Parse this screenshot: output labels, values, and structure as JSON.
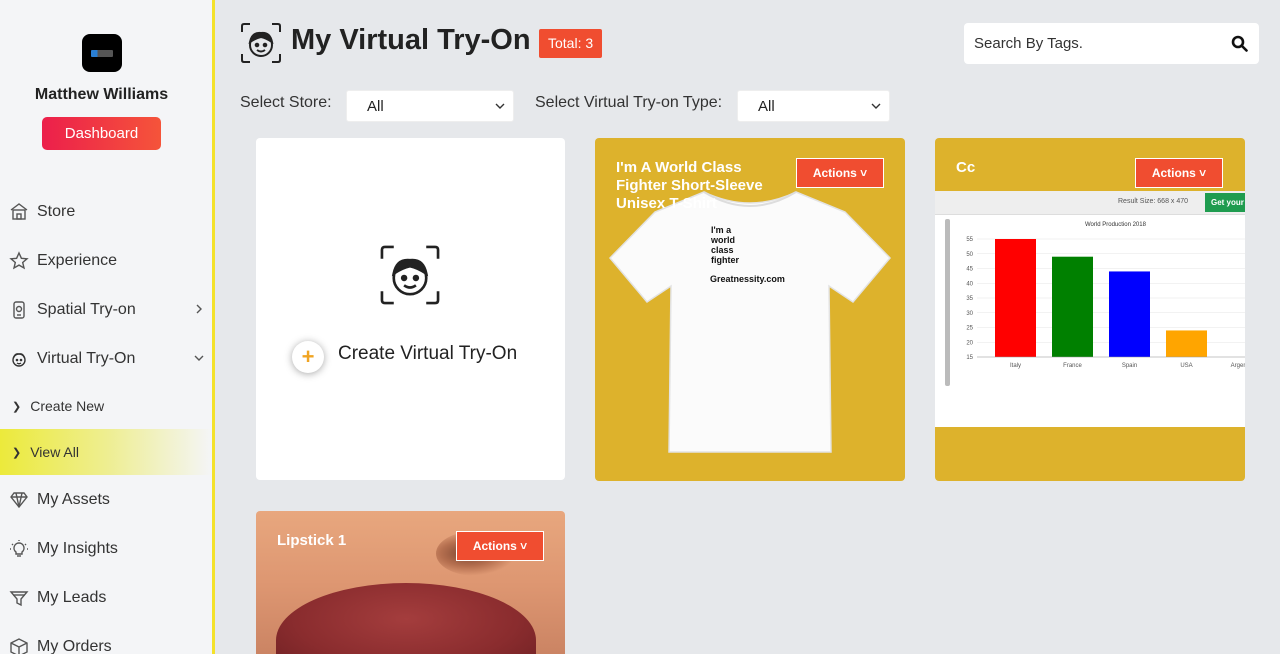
{
  "sidebar": {
    "user_name": "Matthew Williams",
    "dashboard_label": "Dashboard",
    "items": [
      {
        "label": "Store",
        "icon": "store-icon"
      },
      {
        "label": "Experience",
        "icon": "star-icon"
      },
      {
        "label": "Spatial Try-on",
        "icon": "phone-ar-icon"
      },
      {
        "label": "Virtual Try-On",
        "icon": "face-icon"
      },
      {
        "label": "My Assets",
        "icon": "diamond-icon"
      },
      {
        "label": "My Insights",
        "icon": "bulb-icon"
      },
      {
        "label": "My Leads",
        "icon": "funnel-icon"
      },
      {
        "label": "My Orders",
        "icon": "box-icon"
      }
    ],
    "sub_items": [
      {
        "label": "Create New"
      },
      {
        "label": "View All"
      }
    ]
  },
  "header": {
    "title": "My Virtual Try-On",
    "total_badge": "Total: 3",
    "search_placeholder": "Search By Tags."
  },
  "filters": {
    "store_label": "Select Store:",
    "store_value": "All",
    "type_label": "Select Virtual Try-on Type:",
    "type_value": "All"
  },
  "cards": {
    "create_label": "Create Virtual Try-On",
    "actions_label": "Actions",
    "items": [
      {
        "title": "I'm A World Class Fighter Short-Sleeve Unisex T-Shirt",
        "shirt_lines": [
          "I'm a",
          "world",
          "class",
          "fighter"
        ],
        "shirt_site": "Greatnessity.com"
      },
      {
        "title": "Cc"
      },
      {
        "title": "Lipstick 1"
      }
    ]
  },
  "chart_shot": {
    "result_size": "Result Size: 668 x 470",
    "get_button": "Get your",
    "chart_title": "World Production 2018",
    "y_ticks": [
      "55",
      "50",
      "45",
      "40",
      "35",
      "30",
      "25",
      "20",
      "15"
    ],
    "bars": [
      {
        "label": "Italy",
        "value": 55,
        "color": "#ff0000"
      },
      {
        "label": "France",
        "value": 49,
        "color": "#008000"
      },
      {
        "label": "Spain",
        "value": 44,
        "color": "#0000ff"
      },
      {
        "label": "USA",
        "value": 24,
        "color": "#ffa500"
      },
      {
        "label": "Argentina",
        "value": 15,
        "color": "#888888"
      }
    ]
  },
  "colors": {
    "accent": "#f04d30",
    "card_yellow": "#ddb22c",
    "highlight": "#ecea3b"
  }
}
